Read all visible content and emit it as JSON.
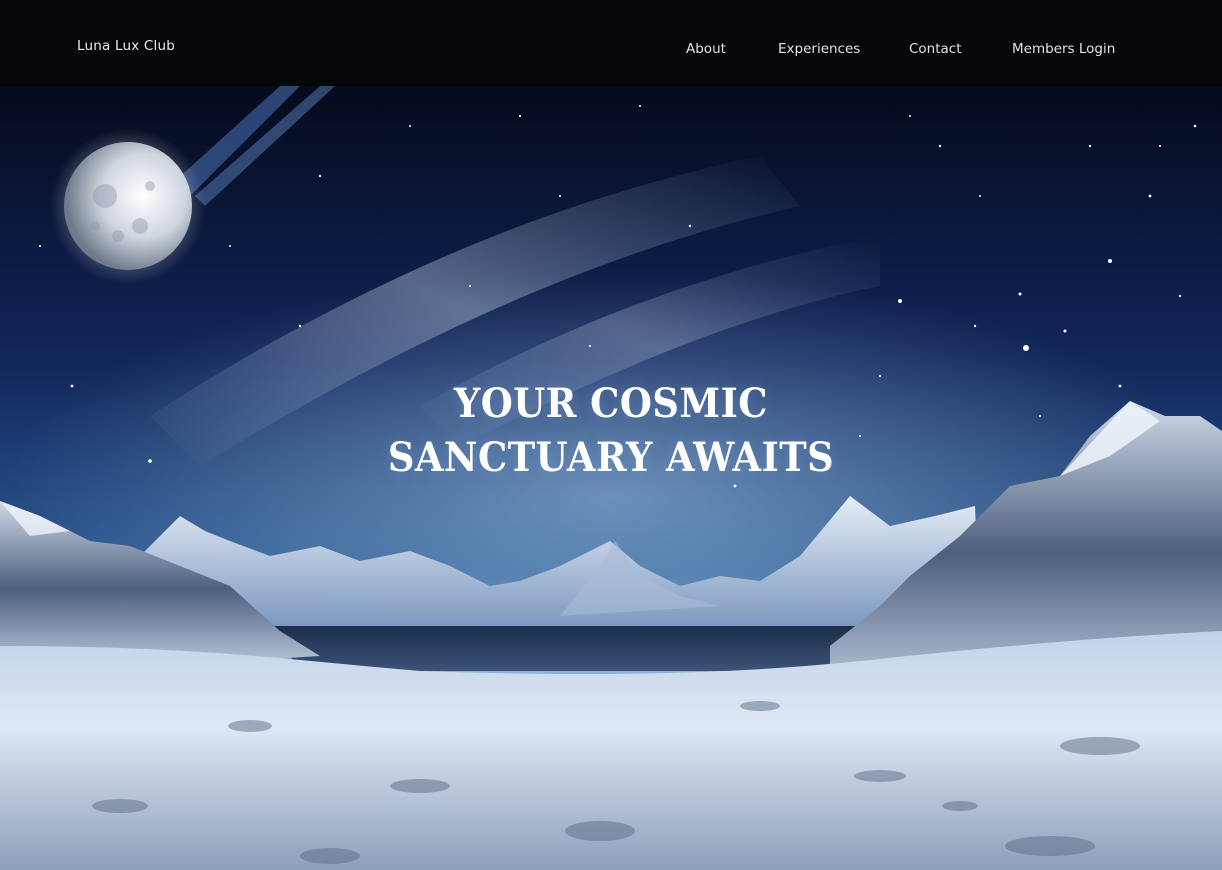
{
  "site": {
    "brand": "Luna Lux Club"
  },
  "nav": {
    "items": [
      {
        "label": "About"
      },
      {
        "label": "Experiences"
      },
      {
        "label": "Contact"
      },
      {
        "label": "Members Login"
      }
    ]
  },
  "hero": {
    "headline_line1": "YOUR COSMIC",
    "headline_line2": "SANCTUARY AWAITS"
  },
  "colors": {
    "header_bg": "#05060a",
    "sky_deep": "#0a1430",
    "sky_mid": "#1d3a72",
    "horizon_glow": "#bcd8f2",
    "snow": "#dfe8f5",
    "text": "#ffffff"
  }
}
